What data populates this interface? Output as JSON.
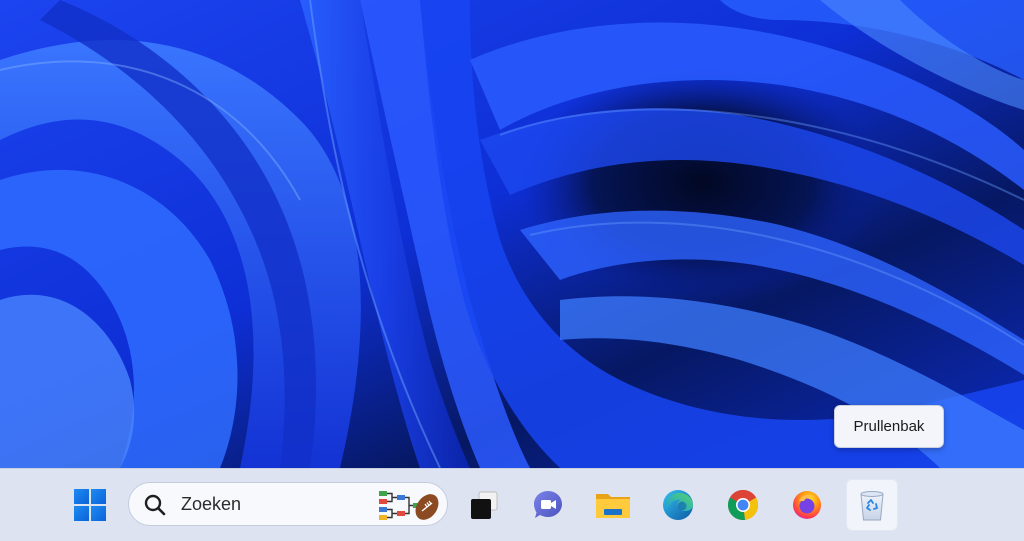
{
  "taskbar": {
    "background": "#dde3f1",
    "start_icon": "windows-logo-icon",
    "search": {
      "label": "Zoeken",
      "icon": "search-icon",
      "highlight_icon": "search-highlight-football-bracket-icon"
    },
    "apps": [
      {
        "name": "task-view",
        "icon": "task-view-icon"
      },
      {
        "name": "teams-meet",
        "icon": "video-chat-icon"
      },
      {
        "name": "file-explorer",
        "icon": "folder-icon"
      },
      {
        "name": "edge",
        "icon": "edge-icon"
      },
      {
        "name": "chrome",
        "icon": "chrome-icon"
      },
      {
        "name": "firefox",
        "icon": "firefox-icon"
      },
      {
        "name": "recycle-bin",
        "icon": "recycle-bin-icon",
        "active": true
      }
    ]
  },
  "tooltip": {
    "text": "Prullenbak"
  },
  "wallpaper": {
    "name": "Windows 11 Bloom (blue)",
    "colors": [
      "#0b1f9e",
      "#1b47ff",
      "#2d6bff",
      "#06104a"
    ]
  }
}
